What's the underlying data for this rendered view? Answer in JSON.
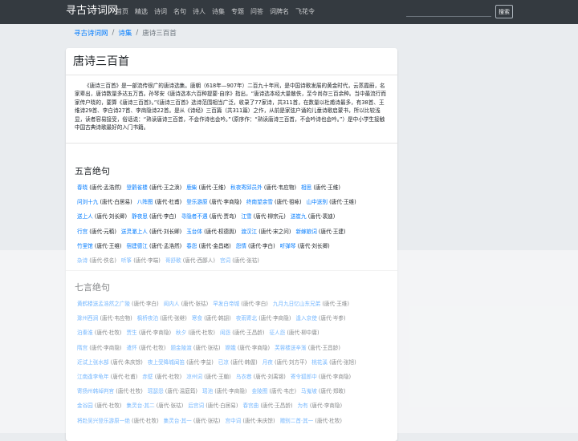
{
  "nav": {
    "brand": "寻古诗词网",
    "links": [
      "首页",
      "精选",
      "诗词",
      "名句",
      "诗人",
      "诗集",
      "专题",
      "问答",
      "词牌名",
      "飞花令"
    ],
    "search_placeholder": "",
    "search_button": "搜索"
  },
  "breadcrumb": {
    "home": "寻古诗词网",
    "section": "诗集",
    "current": "唐诗三百首"
  },
  "page": {
    "title": "唐诗三百首",
    "intro": "《唐诗三百首》是一部流传很广的唐诗选集。唐朝（618年—907年）二百九十年间，是中国诗歌发展的黄金时代，云蒸霞蔚，名家辈出，唐诗数量多达五万首。孙琴安《唐诗选本六百种提要·自序》指出，“唐诗选本经大量散佚，至今尚存三百余种。当中最流行而家传户晓的，要算《唐诗三百首》。”《唐诗三百首》选诗范围相当广泛，收录了77家诗，共311首，在数量以杜甫诗最多，有38首、王维诗29首、李白诗27首、李商隐诗22首。是从《诗经》三百篇（共311篇）之作，从前是家弦户诵的儿童诗歌启蒙书，所以比较浅显，读者容易接受，俗话说：“熟读唐诗三百首，不会作诗也会吟。”（原序作：“熟读唐诗三百首，不会吟诗也会吟。”）是中小学生接触中国古典诗歌最好的入门书籍。"
  },
  "sections": [
    {
      "title": "五言绝句",
      "rows": [
        [
          {
            "t": "春晓",
            "a": "(唐代·孟浩然)"
          },
          {
            "t": "登鹳雀楼",
            "a": "(唐代·王之涣)"
          },
          {
            "t": "鹿柴",
            "a": "(唐代·王维)"
          },
          {
            "t": "秋夜寄邱员外",
            "a": "(唐代·韦应物)"
          },
          {
            "t": "相思",
            "a": "(唐代·王维)"
          }
        ],
        [
          {
            "t": "问刘十九",
            "a": "(唐代·白居易)"
          },
          {
            "t": "八阵图",
            "a": "(唐代·杜甫)"
          },
          {
            "t": "登乐游原",
            "a": "(唐代·李商隐)"
          },
          {
            "t": "终南望余雪",
            "a": "(唐代·祖咏)"
          },
          {
            "t": "山中送别",
            "a": "(唐代·王维)"
          }
        ],
        [
          {
            "t": "送上人",
            "a": "(唐代·刘长卿)"
          },
          {
            "t": "静夜思",
            "a": "(唐代·李白)"
          },
          {
            "t": "寻隐者不遇",
            "a": "(唐代·贾岛)"
          },
          {
            "t": "江雪",
            "a": "(唐代·柳宗元)"
          },
          {
            "t": "送崔九",
            "a": "(唐代·裴迪)"
          }
        ],
        [
          {
            "t": "行宫",
            "a": "(唐代·元稹)"
          },
          {
            "t": "送灵澈上人",
            "a": "(唐代·刘长卿)"
          },
          {
            "t": "玉台体",
            "a": "(唐代·权德舆)"
          },
          {
            "t": "渡汉江",
            "a": "(唐代·宋之问)"
          },
          {
            "t": "新嫁娘词",
            "a": "(唐代·王建)"
          }
        ],
        [
          {
            "t": "竹里馆",
            "a": "(唐代·王维)"
          },
          {
            "t": "宿建德江",
            "a": "(唐代·孟浩然)"
          },
          {
            "t": "春怨",
            "a": "(唐代·金昌绪)"
          },
          {
            "t": "怨情",
            "a": "(唐代·李白)"
          },
          {
            "t": "听弹琴",
            "a": "(唐代·刘长卿)"
          }
        ],
        [
          {
            "t": "杂诗",
            "a": "(唐代·佚名)"
          },
          {
            "t": "听筝",
            "a": "(唐代·李端)"
          },
          {
            "t": "哥舒歌",
            "a": "(唐代·西鄙人)"
          },
          {
            "t": "宫词",
            "a": "(唐代·张祜)"
          }
        ]
      ]
    },
    {
      "title": "七言绝句",
      "rows": [
        [
          {
            "t": "黄鹤楼送孟浩然之广陵",
            "a": "(唐代·李白)"
          },
          {
            "t": "闺内人",
            "a": "(唐代·张祜)"
          },
          {
            "t": "早发白帝城",
            "a": "(唐代·李白)"
          },
          {
            "t": "九月九日忆山东兄弟",
            "a": "(唐代·王维)"
          }
        ],
        [
          {
            "t": "滁州西涧",
            "a": "(唐代·韦应物)"
          },
          {
            "t": "枫桥夜泊",
            "a": "(唐代·张继)"
          },
          {
            "t": "寒食",
            "a": "(唐代·韩翃)"
          },
          {
            "t": "夜雨寄北",
            "a": "(唐代·李商隐)"
          },
          {
            "t": "逢入京使",
            "a": "(唐代·岑参)"
          }
        ],
        [
          {
            "t": "泊秦淮",
            "a": "(唐代·杜牧)"
          },
          {
            "t": "贾生",
            "a": "(唐代·李商隐)"
          },
          {
            "t": "秋夕",
            "a": "(唐代·杜牧)"
          },
          {
            "t": "闺怨",
            "a": "(唐代·王昌龄)"
          },
          {
            "t": "征人怨",
            "a": "(唐代·柳中庸)"
          }
        ],
        [
          {
            "t": "隋宫",
            "a": "(唐代·李商隐)"
          },
          {
            "t": "遣怀",
            "a": "(唐代·杜牧)"
          },
          {
            "t": "题金陵渡",
            "a": "(唐代·张祜)"
          },
          {
            "t": "嫦娥",
            "a": "(唐代·李商隐)"
          },
          {
            "t": "芙蓉楼送辛渐",
            "a": "(唐代·王昌龄)"
          }
        ],
        [
          {
            "t": "近试上张水部",
            "a": "(唐代·朱庆馀)"
          },
          {
            "t": "夜上受降城闻笛",
            "a": "(唐代·李益)"
          },
          {
            "t": "已凉",
            "a": "(唐代·韩偓)"
          },
          {
            "t": "月夜",
            "a": "(唐代·刘方平)"
          },
          {
            "t": "桃花溪",
            "a": "(唐代·张旭)"
          }
        ],
        [
          {
            "t": "江南逢李龟年",
            "a": "(唐代·杜甫)"
          },
          {
            "t": "赤壁",
            "a": "(唐代·杜牧)"
          },
          {
            "t": "凉州词",
            "a": "(唐代·王翰)"
          },
          {
            "t": "乌衣巷",
            "a": "(唐代·刘禹锡)"
          },
          {
            "t": "寄令狐郎中",
            "a": "(唐代·李商隐)"
          }
        ],
        [
          {
            "t": "寄扬州韩绰判官",
            "a": "(唐代·杜牧)"
          },
          {
            "t": "瑶瑟怨",
            "a": "(唐代·温庭筠)"
          },
          {
            "t": "瑶池",
            "a": "(唐代·李商隐)"
          },
          {
            "t": "金陵图",
            "a": "(唐代·韦庄)"
          },
          {
            "t": "马嵬坡",
            "a": "(唐代·郑畋)"
          }
        ],
        [
          {
            "t": "金谷园",
            "a": "(唐代·杜牧)"
          },
          {
            "t": "集灵台·其二",
            "a": "(唐代·张祜)"
          },
          {
            "t": "后宫词",
            "a": "(唐代·白居易)"
          },
          {
            "t": "春宫曲",
            "a": "(唐代·王昌龄)"
          },
          {
            "t": "为有",
            "a": "(唐代·李商隐)"
          }
        ],
        [
          {
            "t": "将赴吴兴登乐游原一绝",
            "a": "(唐代·杜牧)"
          },
          {
            "t": "集灵台·其一",
            "a": "(唐代·张祜)"
          },
          {
            "t": "宫中词",
            "a": "(唐代·朱庆馀)"
          },
          {
            "t": "赠别二首·其一",
            "a": "(唐代·杜牧)"
          }
        ]
      ]
    }
  ]
}
